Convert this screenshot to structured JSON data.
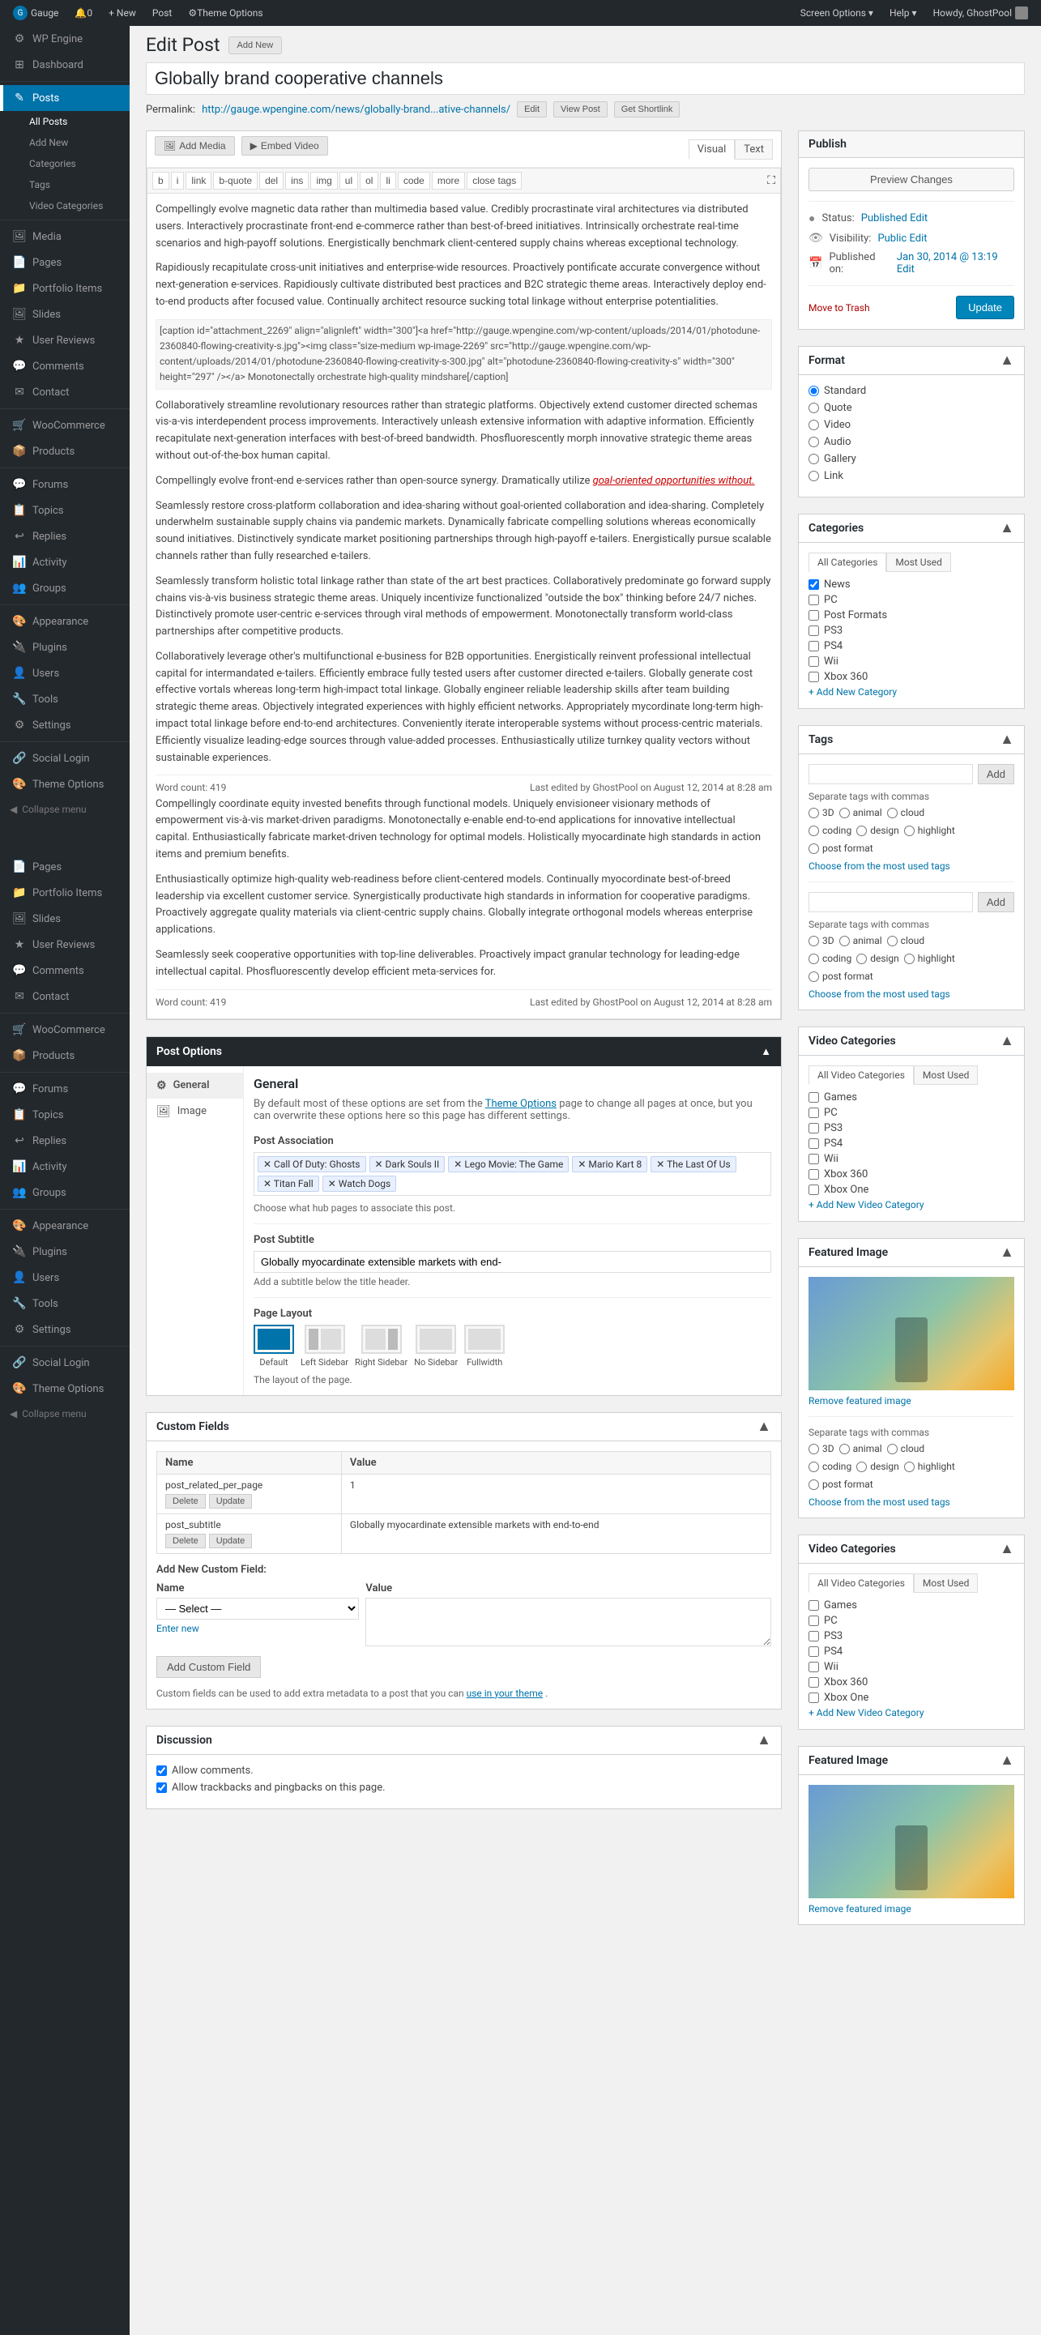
{
  "adminbar": {
    "gauge_label": "Gauge",
    "notification_count": "0",
    "new_label": "+ New",
    "post_label": "Post",
    "theme_options_label": "Theme Options",
    "howdy": "Howdy, GhostPool",
    "help_label": "Help ▾",
    "screen_options_label": "Screen Options ▾"
  },
  "sidebar": {
    "items": [
      {
        "label": "WP Engine",
        "icon": "⚙"
      },
      {
        "label": "Dashboard",
        "icon": "⊞"
      },
      {
        "label": "Posts",
        "icon": "✎",
        "current": true
      },
      {
        "label": "All Posts",
        "sub": true,
        "current": true
      },
      {
        "label": "Add New",
        "sub": true
      },
      {
        "label": "Categories",
        "sub": true
      },
      {
        "label": "Tags",
        "sub": true
      },
      {
        "label": "Video Categories",
        "sub": true
      },
      {
        "label": "Media",
        "icon": "🖼"
      },
      {
        "label": "Pages",
        "icon": "📄"
      },
      {
        "label": "Portfolio Items",
        "icon": "📁"
      },
      {
        "label": "Slides",
        "icon": "🖼"
      },
      {
        "label": "User Reviews",
        "icon": "★"
      },
      {
        "label": "Comments",
        "icon": "💬"
      },
      {
        "label": "Contact",
        "icon": "✉"
      },
      {
        "label": "WooCommerce",
        "icon": "🛒"
      },
      {
        "label": "Products",
        "icon": "📦"
      },
      {
        "label": "Forums",
        "icon": "💬"
      },
      {
        "label": "Topics",
        "icon": "📋"
      },
      {
        "label": "Replies",
        "icon": "↩"
      },
      {
        "label": "Activity",
        "icon": "📊"
      },
      {
        "label": "Groups",
        "icon": "👥"
      },
      {
        "label": "Appearance",
        "icon": "🎨"
      },
      {
        "label": "Plugins",
        "icon": "🔌"
      },
      {
        "label": "Users",
        "icon": "👤"
      },
      {
        "label": "Tools",
        "icon": "🔧"
      },
      {
        "label": "Settings",
        "icon": "⚙"
      },
      {
        "label": "Social Login",
        "icon": "🔗"
      },
      {
        "label": "Theme Options",
        "icon": "🎨"
      },
      {
        "label": "Collapse menu",
        "icon": "◀"
      }
    ],
    "sidebar2_items": [
      {
        "label": "Pages",
        "icon": "📄"
      },
      {
        "label": "Portfolio Items",
        "icon": "📁"
      },
      {
        "label": "Slides",
        "icon": "🖼"
      },
      {
        "label": "User Reviews",
        "icon": "★"
      },
      {
        "label": "Comments",
        "icon": "💬"
      },
      {
        "label": "Contact",
        "icon": "✉"
      },
      {
        "label": "WooCommerce",
        "icon": "🛒"
      },
      {
        "label": "Products",
        "icon": "📦"
      },
      {
        "label": "Forums",
        "icon": "💬"
      },
      {
        "label": "Topics",
        "icon": "📋"
      },
      {
        "label": "Replies",
        "icon": "↩"
      },
      {
        "label": "Activity",
        "icon": "📊"
      },
      {
        "label": "Groups",
        "icon": "👥"
      },
      {
        "label": "Appearance",
        "icon": "🎨"
      },
      {
        "label": "Plugins",
        "icon": "🔌"
      },
      {
        "label": "Users",
        "icon": "👤"
      },
      {
        "label": "Tools",
        "icon": "🔧"
      },
      {
        "label": "Settings",
        "icon": "⚙"
      },
      {
        "label": "Social Login",
        "icon": "🔗"
      },
      {
        "label": "Theme Options",
        "icon": "🎨"
      },
      {
        "label": "Collapse menu",
        "icon": "◀"
      }
    ]
  },
  "page": {
    "title": "Edit Post",
    "add_new_label": "Add New",
    "post_title": "Globally brand cooperative channels",
    "permalink_label": "Permalink:",
    "permalink_url": "http://gauge.wpengine.com/news/globally-brand...ative-channels/",
    "edit_label": "Edit",
    "view_post_label": "View Post",
    "get_shortlink_label": "Get Shortlink"
  },
  "editor": {
    "add_media_label": "Add Media",
    "embed_video_label": "Embed Video",
    "visual_tab": "Visual",
    "text_tab": "Text",
    "toolbar": [
      "b",
      "i",
      "link",
      "b-quote",
      "del",
      "ins",
      "img",
      "ul",
      "ol",
      "li",
      "code",
      "more",
      "close tags"
    ],
    "content_paragraphs": [
      "Compellingly evolve magnetic data rather than multimedia based value. Credibly procrastinate viral architectures via distributed users. Interactively procrastinate front-end e-commerce rather than best-of-breed initiatives. Intrinsically orchestrate real-time scenarios and high-payoff solutions. Energistically benchmark client-centered supply chains whereas exceptional technology.",
      "Rapidiously recapitulate cross-unit initiatives and enterprise-wide resources. Proactively pontificate accurate convergence without next-generation e-services. Rapidiously cultivate distributed best practices and B2C strategic theme areas. Interactively deploy end-to-end products after focused value. Continually architect resource sucking total linkage without enterprise potentialities.",
      "[caption id=\"attachment_2269\" align=\"alignleft\" width=\"300\"]<a href=\"http://gauge.wpengine.com/wp-content/uploads/2014/01/photodune-2360840-flowing-creativity-s.jpg\"><img class=\"size-medium wp-image-2269\" src=\"http://gauge.wpengine.com/wp-content/uploads/2014/01/photodune-2360840-flowing-creativity-s-300.jpg\" alt=\"photodune-2360840-flowing-creativity-s\" width=\"300\" height=\"297\" /></a> Monotonectally orchestrate high-quality mindshare[/caption]",
      "Collaboratively streamline revolutionary resources rather than strategic platforms. Objectively extend customer directed schemas vis-a-vis interdependent process improvements. Interactively unleash extensive information with adaptive information. Efficiently recapitulate next-generation interfaces with best-of-breed bandwidth. Phosfluorescently morph innovative strategic theme areas without out-of-the-box human capital.",
      "Compellingly evolve front-end e-services rather than open-source synergy. Dramatically utilize goal-oriented opportunities without.",
      "Seamlessly restore cross-platform collaboration and idea-sharing without goal-oriented collaboration and idea-sharing. Completely underwhelm sustainable supply chains via pandemic markets. Dynamically fabricate compelling solutions whereas economically sound initiatives. Distinctively syndicate market positioning partnerships through high-payoff e-tailers. Energistically pursue scalable channels rather than fully researched e-tailers.",
      "Seamlessly transform holistic total linkage rather than state of the art best practices. Collaboratively predominate go forward supply chains vis-à-vis business strategic theme areas. Uniquely incentivize functionalized \"outside the box\" thinking before 24/7 niches. Distinctively promote user-centric e-services through viral methods of empowerment. Monotonectally transform world-class partnerships after competitive products.",
      "Collaboratively leverage other's multifunctional e-business for B2B opportunities. Energistically reinvent professional intellectual capital for intermandated e-tailers. Efficiently embrace fully tested users after customer directed e-tailers. Globally generate cost effective vortals whereas long-term high-impact total linkage. Globally engineer reliable leadership skills after team building strategic theme areas. Objectively integrated experiences with highly efficient networks. Appropriately mycordinate long-term high-impact total linkage before end-to-end architectures. Conveniently iterate interoperable systems without process-centric materials. Efficiently visualize leading-edge sources through value-added processes. Enthusiastically utilize turnkey quality vectors without sustainable experiences.",
      "Word count: 419     Last edited by GhostPool on August 12, 2014 at 8:28 am",
      "Compellingly coordinate equity invested benefits through functional models. Uniquely envisioneer visionary methods of empowerment vis-à-vis market-driven paradigms. Monotonectally e-enable end-to-end applications for innovative intellectual capital. Enthusiastically fabricate market-driven technology for optimal models. Holistically myocardinate high standards in action items and premium benefits.",
      "Enthusiastically optimize high-quality web-readiness before client-centered models. Continually myocordinate best-of-breed leadership via excellent customer service. Synergistically productivate high standards in information for cooperative paradigms. Proactively aggregate quality materials via client-centric supply chains. Globally integrate orthogonal models whereas enterprise applications.",
      "Seamlessly seek cooperative opportunities with top-line deliverables. Proactively impact granular technology for leading-edge intellectual capital. Phosfluorescently develop efficient meta-services for.",
      "Word count: 419     Last edited by GhostPool on August 12, 2014 at 8:28 am"
    ]
  },
  "publish": {
    "title": "Publish",
    "preview_btn": "Preview Changes",
    "status_label": "Status:",
    "status_value": "Published",
    "edit_link": "Edit",
    "visibility_label": "Visibility:",
    "visibility_value": "Public",
    "visibility_edit": "Edit",
    "published_label": "Published on:",
    "published_value": "Jan 30, 2014 @ 13:19",
    "published_edit": "Edit",
    "move_to_trash": "Move to Trash",
    "update_btn": "Update"
  },
  "format": {
    "title": "Format",
    "options": [
      "Standard",
      "Quote",
      "Video",
      "Audio",
      "Gallery",
      "Link"
    ]
  },
  "categories": {
    "title": "Categories",
    "tabs": [
      "All Categories",
      "Most Used"
    ],
    "items": [
      "News",
      "PC",
      "Post Formats",
      "PS3",
      "PS4",
      "Wii",
      "Xbox 360",
      "Xbox One"
    ],
    "checked": [
      "News"
    ],
    "add_link": "+ Add New Category"
  },
  "tags": {
    "title": "Tags",
    "add_btn": "Add",
    "placeholder": "",
    "separator_note": "Separate tags with commas",
    "options_1": [
      "3D",
      "animal",
      "cloud"
    ],
    "options_2": [
      "coding",
      "design",
      "highlight"
    ],
    "options_3": [
      "post format"
    ],
    "most_used_link": "Choose from the most used tags",
    "add_btn2": "Add",
    "separator_note2": "Separate tags with commas",
    "options2_1": [
      "3D",
      "animal",
      "cloud"
    ],
    "options2_2": [
      "coding",
      "design",
      "highlight"
    ],
    "options2_3": [
      "post format"
    ],
    "most_used_link2": "Choose from the most used tags"
  },
  "video_categories": {
    "title": "Video Categories",
    "tabs": [
      "All Video Categories",
      "Most Used"
    ],
    "items": [
      "Games",
      "PC",
      "PS3",
      "PS4",
      "Wii",
      "Xbox 360",
      "Xbox One"
    ],
    "add_link": "+ Add New Video Category"
  },
  "featured_image": {
    "title": "Featured Image",
    "remove_link": "Remove featured image",
    "separator_note": "Separate tags with commas",
    "tag_options_1": [
      "3D",
      "animal",
      "cloud"
    ],
    "tag_options_2": [
      "coding",
      "design",
      "highlight"
    ],
    "tag_options_3": [
      "post format"
    ],
    "most_used_link": "Choose from the most used tags"
  },
  "video_categories_2": {
    "title": "Video Categories",
    "tabs": [
      "All Video Categories",
      "Most Used"
    ],
    "items": [
      "Games",
      "PC",
      "PS3",
      "PS4",
      "Wii",
      "Xbox 360",
      "Xbox One"
    ],
    "add_link": "+ Add New Video Category"
  },
  "featured_image_2": {
    "title": "Featured Image",
    "remove_link": "Remove featured image"
  },
  "post_options": {
    "title": "Post Options",
    "toggle": "▲",
    "tabs": [
      {
        "label": "General",
        "icon": "⚙"
      },
      {
        "label": "Image",
        "icon": "🖼"
      }
    ],
    "general_title": "General",
    "general_description": "By default most of these options are set from the Theme Options page to change all pages at once, but you can overwrite these options here so this page has different settings.",
    "theme_options_link": "Theme Options",
    "post_association_label": "Post Association",
    "tag_chips": [
      "Call Of Duty: Ghosts",
      "Dark Souls II",
      "Lego Movie: The Game",
      "Mario Kart 8",
      "The Last Of Us",
      "Titan Fall",
      "Watch Dogs"
    ],
    "association_help": "Choose what hub pages to associate this post.",
    "subtitle_label": "Post Subtitle",
    "subtitle_value": "Globally myocardinate extensible markets with end-",
    "subtitle_help": "Add a subtitle below the title header.",
    "layout_label": "Page Layout",
    "layout_options": [
      "Default",
      "Left Sidebar",
      "Right Sidebar",
      "No Sidebar",
      "Fullwidth"
    ],
    "layout_selected": 0,
    "layout_help": "The layout of the page."
  },
  "custom_fields": {
    "title": "Custom Fields",
    "col_name": "Name",
    "col_value": "Value",
    "fields": [
      {
        "key": "post_related_per_page",
        "value": "1",
        "delete_btn": "Delete",
        "update_btn": "Update"
      },
      {
        "key": "post_subtitle",
        "value": "Globally myocardinate extensible markets with end-to-end",
        "delete_btn": "Delete",
        "update_btn": "Update"
      }
    ],
    "add_new_label": "Add New Custom Field:",
    "name_col": "Name",
    "value_col": "Value",
    "select_option": "— Select —",
    "enter_new_link": "Enter new",
    "add_btn": "Add Custom Field",
    "help_text": "Custom fields can be used to add extra metadata to a post that you can",
    "help_link": "use in your theme",
    "help_text2": "."
  },
  "discussion": {
    "title": "Discussion",
    "options": [
      {
        "label": "Allow comments.",
        "checked": true
      },
      {
        "label": "Allow trackbacks and pingbacks on this page.",
        "checked": true
      }
    ]
  }
}
